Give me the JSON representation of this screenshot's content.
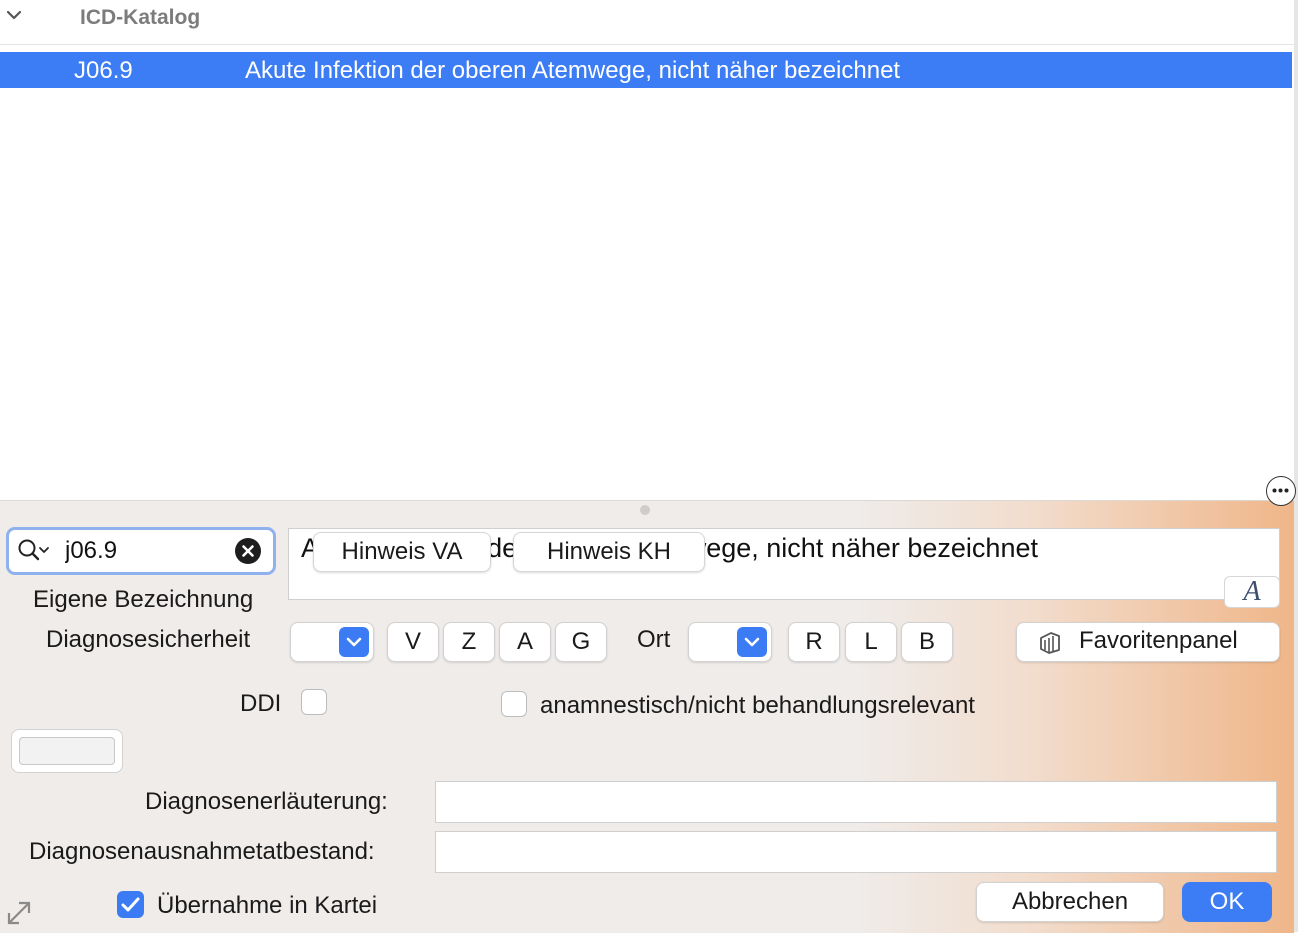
{
  "catalog": {
    "group_title": "ICD-Katalog",
    "selected_row": {
      "code": "J06.9",
      "text": "Akute Infektion der oberen Atemwege, nicht näher bezeichnet"
    }
  },
  "search": {
    "value": "j06.9"
  },
  "description": {
    "text": "Akute Infektion der oberen Atemwege, nicht näher bezeichnet",
    "hint_va": "Hinweis VA",
    "hint_kh": "Hinweis KH",
    "font_button": "A"
  },
  "labels": {
    "eigene_bezeichnung": "Eigene Bezeichnung",
    "diagnosesicherheit": "Diagnosesicherheit",
    "ort": "Ort",
    "ddi": "DDI",
    "anamnestisch": "anamnestisch/nicht behandlungsrelevant",
    "erlaeuterung": "Diagnosenerläuterung:",
    "ausnahmetatbestand": "Diagnosenausnahmetatbestand:",
    "uebernahme": "Übernahme in Kartei"
  },
  "sicherheit_buttons": [
    "V",
    "Z",
    "A",
    "G"
  ],
  "ort_buttons": [
    "R",
    "L",
    "B"
  ],
  "favorites_button": "Favoritenpanel",
  "checkboxes": {
    "ddi": false,
    "anamnestisch": false,
    "uebernahme": true
  },
  "actions": {
    "cancel": "Abbrechen",
    "ok": "OK"
  },
  "colors": {
    "selection": "#3c7df5",
    "accent": "#3b7cf4"
  },
  "icons": {
    "group_toggle": "chevron-down-icon",
    "search": "magnifier-dropdown-icon",
    "clear": "clear-circle-icon",
    "favorites": "layers-icon",
    "more": "ellipsis-circle-icon",
    "resize": "resize-arrows-icon",
    "check": "checkmark-icon"
  }
}
